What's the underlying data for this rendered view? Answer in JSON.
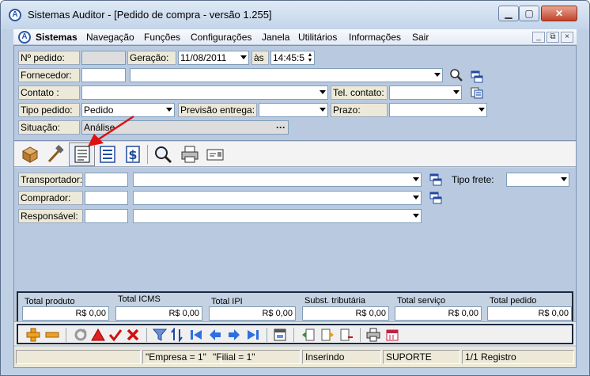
{
  "window": {
    "title": "Sistemas Auditor - [Pedido de compra - versão 1.255]",
    "app_icon": "A"
  },
  "menu": {
    "items": [
      "Sistemas",
      "Navegação",
      "Funções",
      "Configurações",
      "Janela",
      "Utilitários",
      "Informações",
      "Sair"
    ]
  },
  "form": {
    "pedido": {
      "label": "Nº pedido:",
      "value": ""
    },
    "geracao": {
      "label": "Geração:",
      "date": "11/08/2011",
      "as_label": "às",
      "time": "14:45:5"
    },
    "fornecedor": {
      "label": "Fornecedor:",
      "code": "",
      "name": ""
    },
    "contato": {
      "label": "Contato :",
      "value": ""
    },
    "tel_contato": {
      "label": "Tel. contato:",
      "value": ""
    },
    "tipo_pedido": {
      "label": "Tipo pedido:",
      "value": "Pedido"
    },
    "previsao": {
      "label": "Previsão entrega:",
      "value": ""
    },
    "prazo": {
      "label": "Prazo:",
      "value": ""
    },
    "situacao": {
      "label": "Situação:",
      "value": "Análise",
      "ellipsis": "···"
    }
  },
  "toolbar_icons": [
    "package-icon",
    "hammer-icon",
    "notepad-icon",
    "list-icon",
    "dollar-icon",
    "magnifier-icon",
    "printer-icon",
    "card-icon"
  ],
  "detail": {
    "transportador": {
      "label": "Transportador:",
      "code": "",
      "name": ""
    },
    "tipo_frete": {
      "label": "Tipo frete:",
      "value": ""
    },
    "comprador": {
      "label": "Comprador:",
      "code": "",
      "name": ""
    },
    "responsavel": {
      "label": "Responsável:",
      "code": "",
      "name": ""
    }
  },
  "totals": [
    {
      "label": "Total produto",
      "value": "R$ 0,00"
    },
    {
      "label": "Total ICMS",
      "value": "R$ 0,00"
    },
    {
      "label": "Total IPI",
      "value": "R$ 0,00"
    },
    {
      "label": "Subst. tributária",
      "value": "R$ 0,00"
    },
    {
      "label": "Total serviço",
      "value": "R$ 0,00"
    },
    {
      "label": "Total pedido",
      "value": "R$ 0,00"
    }
  ],
  "statusbar": {
    "empresa": "\"Empresa = 1\"",
    "filial": "\"Filial = 1\"",
    "mode": "Inserindo",
    "user": "SUPORTE",
    "registro": "1/1 Registro"
  },
  "colors": {
    "accent_arrow": "#e01010",
    "title_bar": "#c3d5ea",
    "form_bg": "#b9cae0",
    "totals_border": "#1b2a40"
  }
}
